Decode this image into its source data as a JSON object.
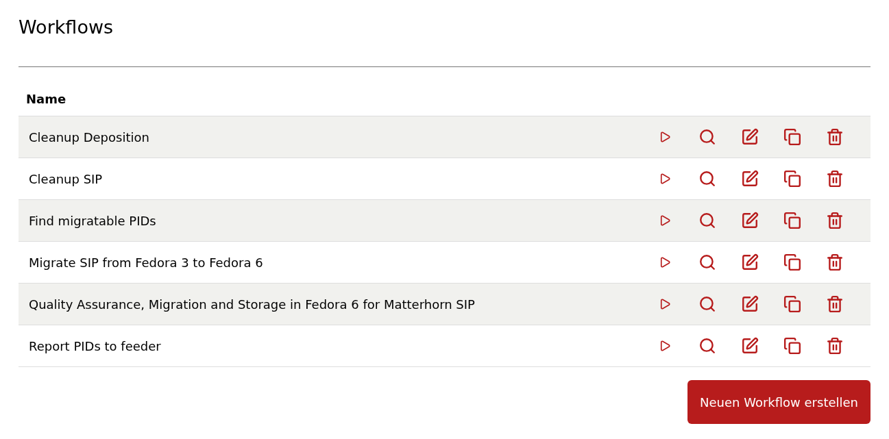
{
  "title": "Workflows",
  "table": {
    "columns": [
      "Name"
    ],
    "rows": [
      {
        "name": "Cleanup Deposition"
      },
      {
        "name": "Cleanup SIP"
      },
      {
        "name": "Find migratable PIDs"
      },
      {
        "name": "Migrate SIP from Fedora 3 to Fedora 6"
      },
      {
        "name": "Quality Assurance, Migration and Storage in Fedora 6 for Matterhorn SIP"
      },
      {
        "name": "Report PIDs to feeder"
      }
    ]
  },
  "create_button": "Neuen Workflow erstellen"
}
